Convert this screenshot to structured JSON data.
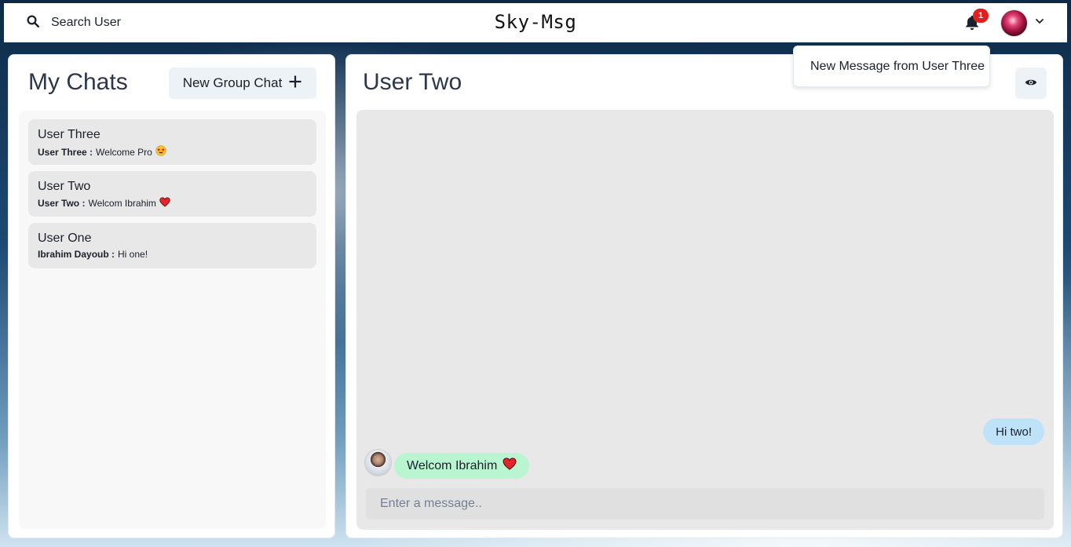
{
  "header": {
    "search_label": "Search User",
    "app_title": "Sky-Msg",
    "notification_count": "1"
  },
  "notification_popup": {
    "message": "New Message from User Three"
  },
  "chats_panel": {
    "title": "My Chats",
    "new_group_label": "New Group Chat",
    "items": [
      {
        "name": "User Three",
        "sender": "User Three :",
        "preview": "Welcome Pro",
        "emoji": "star-struck-emoji"
      },
      {
        "name": "User Two",
        "sender": "User Two :",
        "preview": "Welcom Ibrahim",
        "emoji": "red-heart-emoji"
      },
      {
        "name": "User One",
        "sender": "Ibrahim Dayoub :",
        "preview": "Hi one!",
        "emoji": ""
      }
    ]
  },
  "conversation": {
    "title": "User Two",
    "messages": [
      {
        "text": "Hi two!",
        "side": "right"
      },
      {
        "text": "Welcom Ibrahim",
        "side": "left",
        "emoji": "red-heart-emoji"
      }
    ],
    "input_placeholder": "Enter a message.."
  },
  "colors": {
    "badge": "#e01f1f",
    "sent_bubble": "#bee3f8",
    "received_bubble": "#b9f5d0",
    "panel_bg": "#ffffff",
    "chat_box_bg": "#e8e8e8"
  }
}
